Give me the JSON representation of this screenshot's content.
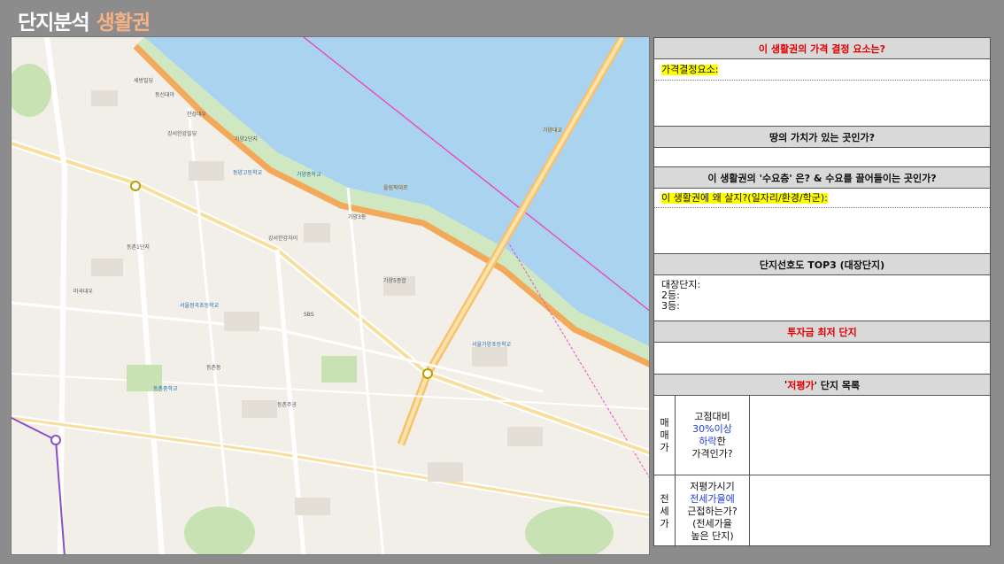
{
  "title": {
    "main": "단지분석",
    "sub": "생활권"
  },
  "map": {
    "labels": [
      {
        "text": "세방빌딩",
        "type": "normal"
      },
      {
        "text": "동신대아",
        "type": "normal"
      },
      {
        "text": "한강대우",
        "type": "normal"
      },
      {
        "text": "강서한강빌딩",
        "type": "normal"
      },
      {
        "text": "가양2단지",
        "type": "normal"
      },
      {
        "text": "동양고등학교",
        "type": "school"
      },
      {
        "text": "가양중학교",
        "type": "school"
      },
      {
        "text": "서울정곡초등학교",
        "type": "school"
      },
      {
        "text": "마곡대우",
        "type": "normal"
      },
      {
        "text": "등촌1단지",
        "type": "normal"
      },
      {
        "text": "가양3동",
        "type": "normal"
      },
      {
        "text": "가양5종합",
        "type": "normal"
      },
      {
        "text": "등촌중학교",
        "type": "school"
      },
      {
        "text": "SBS",
        "type": "normal"
      },
      {
        "text": "서울가양초등학교",
        "type": "school"
      },
      {
        "text": "등촌동",
        "type": "normal"
      },
      {
        "text": "올림픽대로",
        "type": "road"
      },
      {
        "text": "가양대교",
        "type": "road"
      },
      {
        "text": "등촌주공",
        "type": "normal"
      },
      {
        "text": "강서한강자이",
        "type": "normal"
      }
    ]
  },
  "panel": {
    "q1_header": "이 생활권의 가격 결정 요소는?",
    "q1_label": "가격결정요소:",
    "q2_header": "땅의 가치가 있는 곳인가?",
    "q3_header": "이 생활권의 '수요층' 은? & 수요를 끌어들이는 곳인가?",
    "q3_label": "이 생활권에 왜 살지?(일자리/환경/학군):",
    "q4_header": "단지선호도 TOP3 (대장단지)",
    "q4_line1": "대장단지:",
    "q4_line2": "2등:",
    "q4_line3": "3등:",
    "q5_header": "투자금 최저 단지",
    "q6_header_pre": "'",
    "q6_header_red": "저평가",
    "q6_header_post": "' 단지 목록",
    "maemae_label": "매매가",
    "maemae_a": "고점대비",
    "maemae_b": "30%이상",
    "maemae_c": "하락",
    "maemae_d": "한",
    "maemae_e": "가격인가?",
    "jeonse_label": "전세가",
    "jeonse_a": "저평가시기",
    "jeonse_b": "전세가율에",
    "jeonse_c": "근접하는가?",
    "jeonse_d": "(전세가율",
    "jeonse_e": "높은 단지)"
  }
}
